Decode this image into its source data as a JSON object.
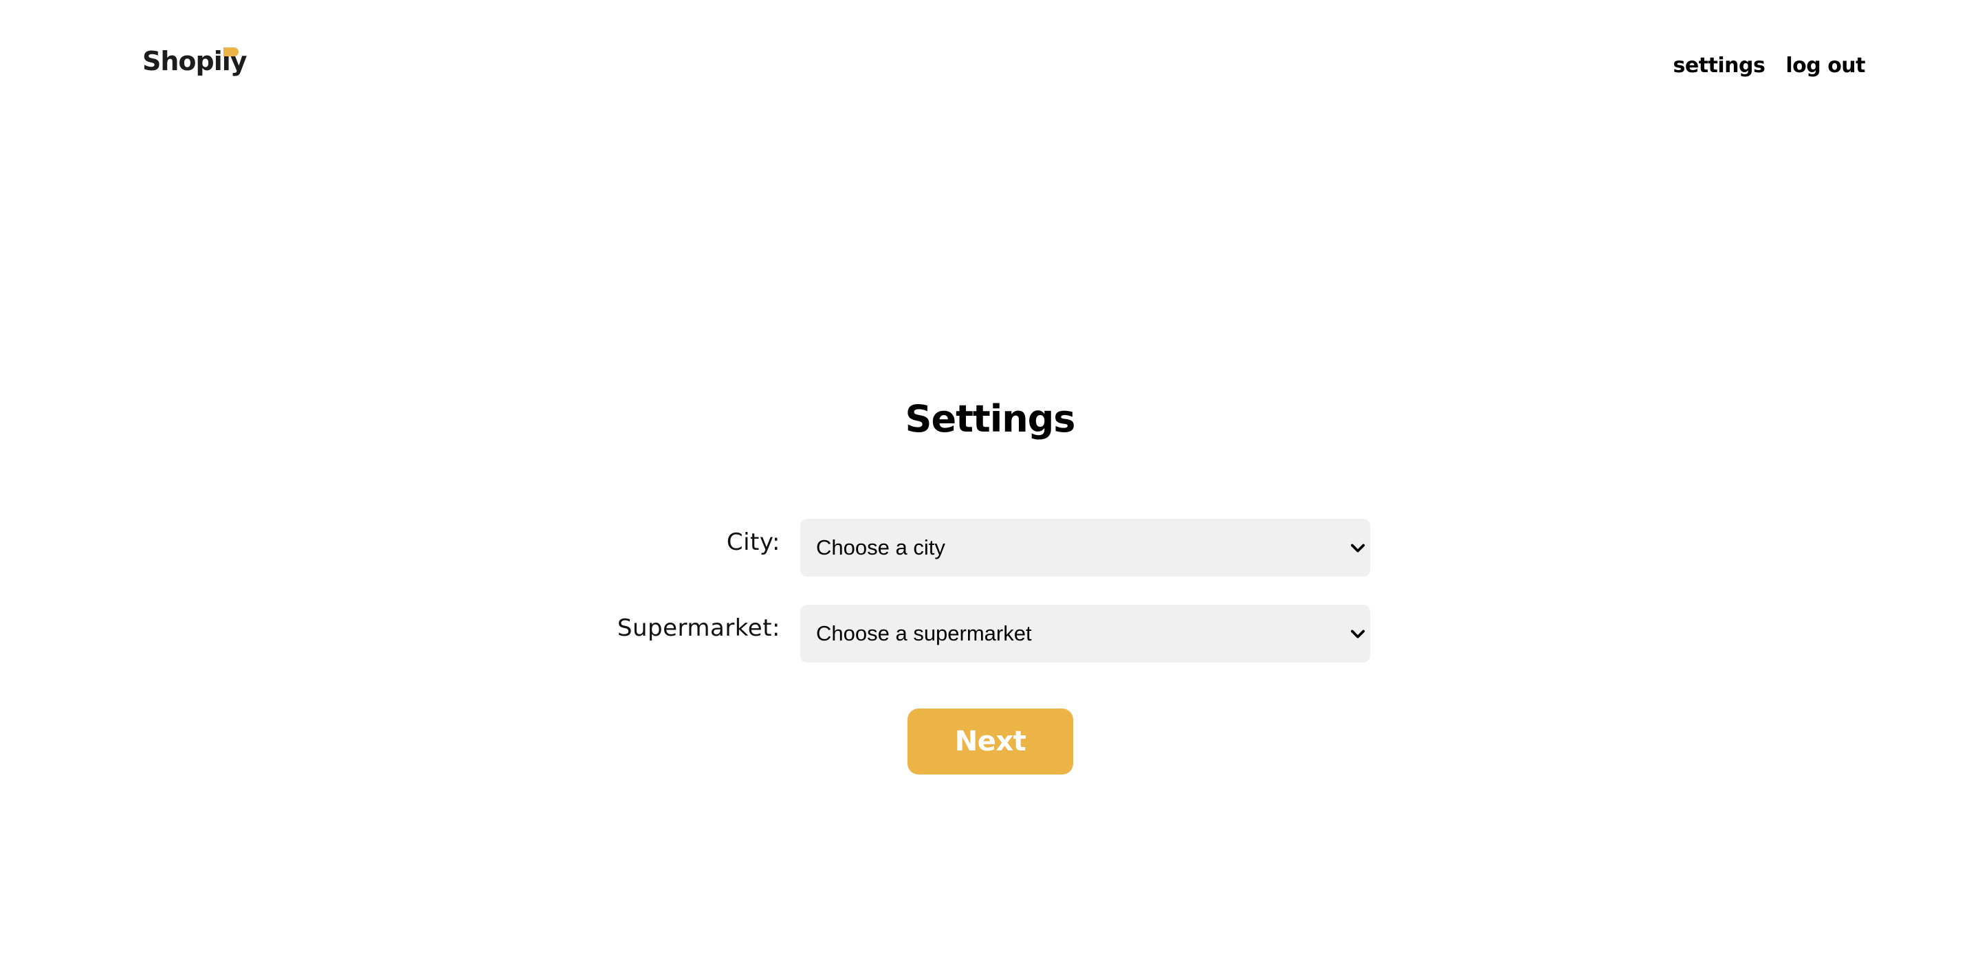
{
  "header": {
    "logo_text": "Shopily",
    "nav": {
      "settings_label": "settings",
      "logout_label": "log out"
    }
  },
  "main": {
    "title": "Settings",
    "fields": {
      "city": {
        "label": "City:",
        "selected": "Choose a city"
      },
      "supermarket": {
        "label": "Supermarket:",
        "selected": "Choose a supermarket"
      }
    },
    "next_label": "Next"
  },
  "icons": {
    "logo_mark": "logo-accent-icon",
    "select_arrow": "chevron-down-icon"
  },
  "colors": {
    "accent": "#ecb347",
    "select_background": "#f0f0f0",
    "text": "#000000"
  }
}
